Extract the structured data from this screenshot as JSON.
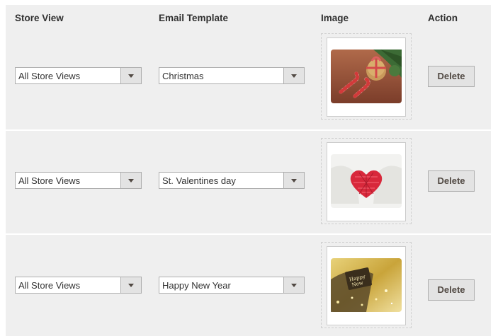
{
  "headers": {
    "store_view": "Store View",
    "email_template": "Email Template",
    "image": "Image",
    "action": "Action"
  },
  "rows": [
    {
      "store_view": "All Store Views",
      "email_template": "Christmas",
      "action_label": "Delete",
      "image_icon": "christmas-cookies-candy-canes-image"
    },
    {
      "store_view": "All Store Views",
      "email_template": "St. Valentines day",
      "action_label": "Delete",
      "image_icon": "valentine-heart-mittens-image"
    },
    {
      "store_view": "All Store Views",
      "email_template": "Happy New Year",
      "action_label": "Delete",
      "image_icon": "new-year-gold-card-image"
    }
  ],
  "colors": {
    "row_background": "#efefef",
    "button_background": "#e3e3e3",
    "border": "#adadad"
  }
}
